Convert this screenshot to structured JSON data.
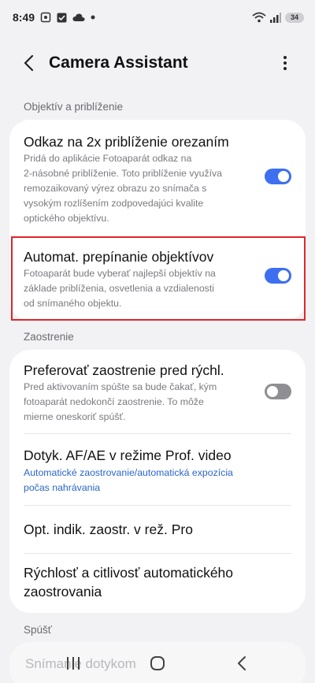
{
  "status": {
    "time": "8:49",
    "battery": "34"
  },
  "header": {
    "title": "Camera Assistant",
    "back_icon": "chevron-left-icon",
    "more_icon": "more-vertical-icon"
  },
  "sections": {
    "lens": "Objektív a priblíženie",
    "focus": "Zaostrenie",
    "shutter": "Spúšť"
  },
  "lens_items": [
    {
      "title": "Odkaz na 2x priblíženie orezaním",
      "lines": [
        "Pridá do aplikácie Fotoaparát odkaz na",
        "2-násobné priblíženie. Toto priblíženie využíva",
        "remozaikovaný výrez obrazu zo snímača s",
        "vysokým rozlíšením zodpovedajúci kvalite",
        "optického objektívu."
      ],
      "toggle": "on"
    },
    {
      "title": "Automat. prepínanie objektívov",
      "lines": [
        "Fotoaparát bude vyberať najlepší objektív na",
        "základe priblíženia, osvetlenia a vzdialenosti",
        "od snímaného objektu."
      ],
      "toggle": "on"
    }
  ],
  "focus_items": [
    {
      "title": "Preferovať zaostrenie pred rýchl.",
      "lines": [
        "Pred aktivovaním spúšte sa bude čakať, kým",
        "fotoaparát nedokončí zaostrenie. To môže",
        "mierne oneskoriť spúšť."
      ],
      "toggle": "off"
    },
    {
      "title": "Dotyk. AF/AE v režime Prof. video",
      "lines": [
        "Automatické zaostrovanie/automatická expozícia",
        "počas nahrávania"
      ]
    },
    {
      "title": "Opt. indik. zaostr. v rež. Pro"
    },
    {
      "title_lines": [
        "Rýchlosť a citlivosť automatického",
        "zaostrovania"
      ]
    }
  ],
  "shutter_items": [
    {
      "title": "Snímanie dotykom"
    }
  ],
  "colors": {
    "accent": "#3e6ff0",
    "link": "#2a66c9",
    "highlight": "#e0252b",
    "background": "#f2f2f4"
  }
}
